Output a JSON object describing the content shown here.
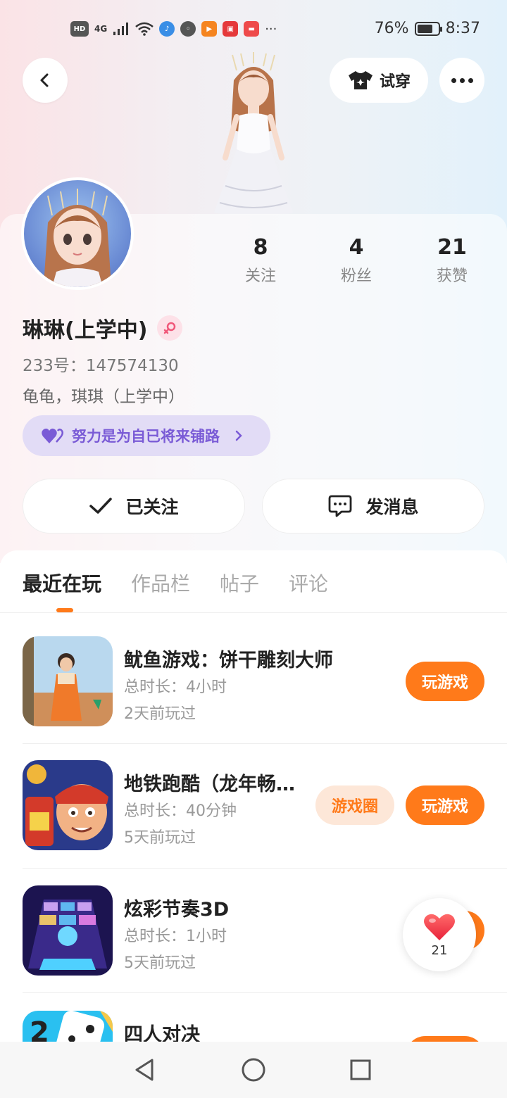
{
  "status_bar": {
    "network_label": "HD",
    "signal_label": "4G",
    "battery_text": "76%",
    "battery_level": 0.76,
    "time": "8:37",
    "overflow": "···",
    "app_icons": [
      "music-icon",
      "wechat-icon",
      "video-icon",
      "reader-icon",
      "shop-icon"
    ]
  },
  "header": {
    "try_on_label": "试穿"
  },
  "profile": {
    "stats": [
      {
        "value": "8",
        "label": "关注"
      },
      {
        "value": "4",
        "label": "粉丝"
      },
      {
        "value": "21",
        "label": "获赞"
      }
    ],
    "name": "琳琳(上学中)",
    "id_text": "233号：147574130",
    "bio": "龟龟，琪琪（上学中）",
    "motto": "努力是为自已将来铺路"
  },
  "actions": {
    "follow_label": "已关注",
    "message_label": "发消息"
  },
  "tabs": [
    {
      "label": "最近在玩",
      "active": true
    },
    {
      "label": "作品栏",
      "active": false
    },
    {
      "label": "帖子",
      "active": false
    },
    {
      "label": "评论",
      "active": false
    }
  ],
  "games": [
    {
      "title": "鱿鱼游戏：饼干雕刻大师",
      "duration": "总时长：4小时",
      "last_played": "2天前玩过",
      "circle_label": "",
      "play_label": "玩游戏"
    },
    {
      "title": "地铁跑酷（龙年畅…",
      "duration": "总时长：40分钟",
      "last_played": "5天前玩过",
      "circle_label": "游戏圈",
      "play_label": "玩游戏"
    },
    {
      "title": "炫彩节奏3D",
      "duration": "总时长：1小时",
      "last_played": "5天前玩过",
      "circle_label": "",
      "play_label": ""
    },
    {
      "title": "四人对决",
      "duration": "",
      "last_played": "",
      "circle_label": "",
      "play_label": ""
    }
  ],
  "like_float": {
    "count": "21"
  },
  "colors": {
    "accent": "#ff7a1a",
    "motto_bg": "#e2dcf6",
    "motto_text": "#7a5bd6"
  }
}
